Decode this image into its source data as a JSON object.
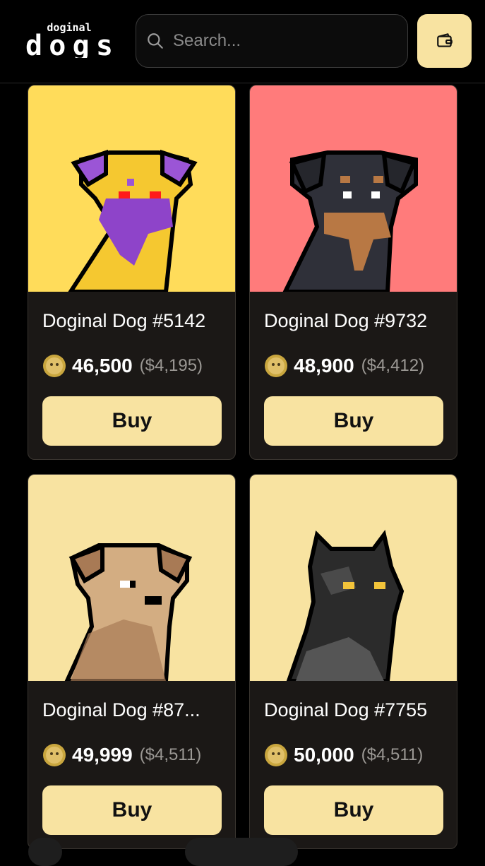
{
  "header": {
    "logo_small": "doginal",
    "logo_big": "dogs",
    "search_placeholder": "Search...",
    "wallet_icon": "wallet-icon"
  },
  "colors": {
    "accent": "#f8e3a1",
    "card_bg": "#1b1816",
    "card1_bg": "#ffdc5a",
    "card2_bg": "#ff7b7b",
    "card3_bg": "#f8e3a1",
    "card4_bg": "#f8e3a1"
  },
  "cards": [
    {
      "title": "Doginal Dog #5142",
      "price": "46,500",
      "usd": "($4,195)",
      "buy_label": "Buy"
    },
    {
      "title": "Doginal Dog #9732",
      "price": "48,900",
      "usd": "($4,412)",
      "buy_label": "Buy"
    },
    {
      "title": "Doginal Dog #87...",
      "price": "49,999",
      "usd": "($4,511)",
      "buy_label": "Buy"
    },
    {
      "title": "Doginal Dog #7755",
      "price": "50,000",
      "usd": "($4,511)",
      "buy_label": "Buy"
    }
  ]
}
